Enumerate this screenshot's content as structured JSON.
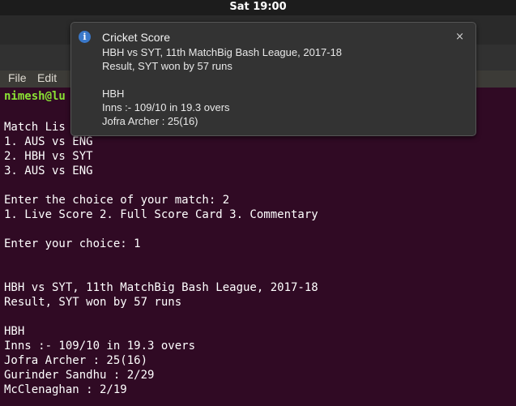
{
  "topbar": {
    "clock": "Sat 19:00"
  },
  "menu": {
    "file": "File",
    "edit": "Edit"
  },
  "terminal": {
    "prompt": "nimesh@lu",
    "lines": [
      "Match Lis",
      "1. AUS vs ENG",
      "2. HBH vs SYT",
      "3. AUS vs ENG",
      "",
      "Enter the choice of your match: 2",
      "1. Live Score 2. Full Score Card 3. Commentary",
      "",
      "Enter your choice: 1",
      "",
      "",
      "HBH vs SYT, 11th MatchBig Bash League, 2017-18",
      "Result, SYT won by 57 runs",
      "",
      "HBH",
      "Inns :- 109/10 in 19.3 overs",
      "Jofra Archer : 25(16)",
      "Gurinder Sandhu : 2/29",
      "McClenaghan : 2/19"
    ]
  },
  "notification": {
    "icon": "info-icon",
    "close_glyph": "×",
    "title": "Cricket Score",
    "lines": [
      "HBH vs SYT, 11th MatchBig Bash League, 2017-18",
      "Result, SYT won by 57 runs",
      "",
      "HBH",
      "Inns :- 109/10 in 19.3 overs",
      "Jofra Archer : 25(16)"
    ]
  }
}
